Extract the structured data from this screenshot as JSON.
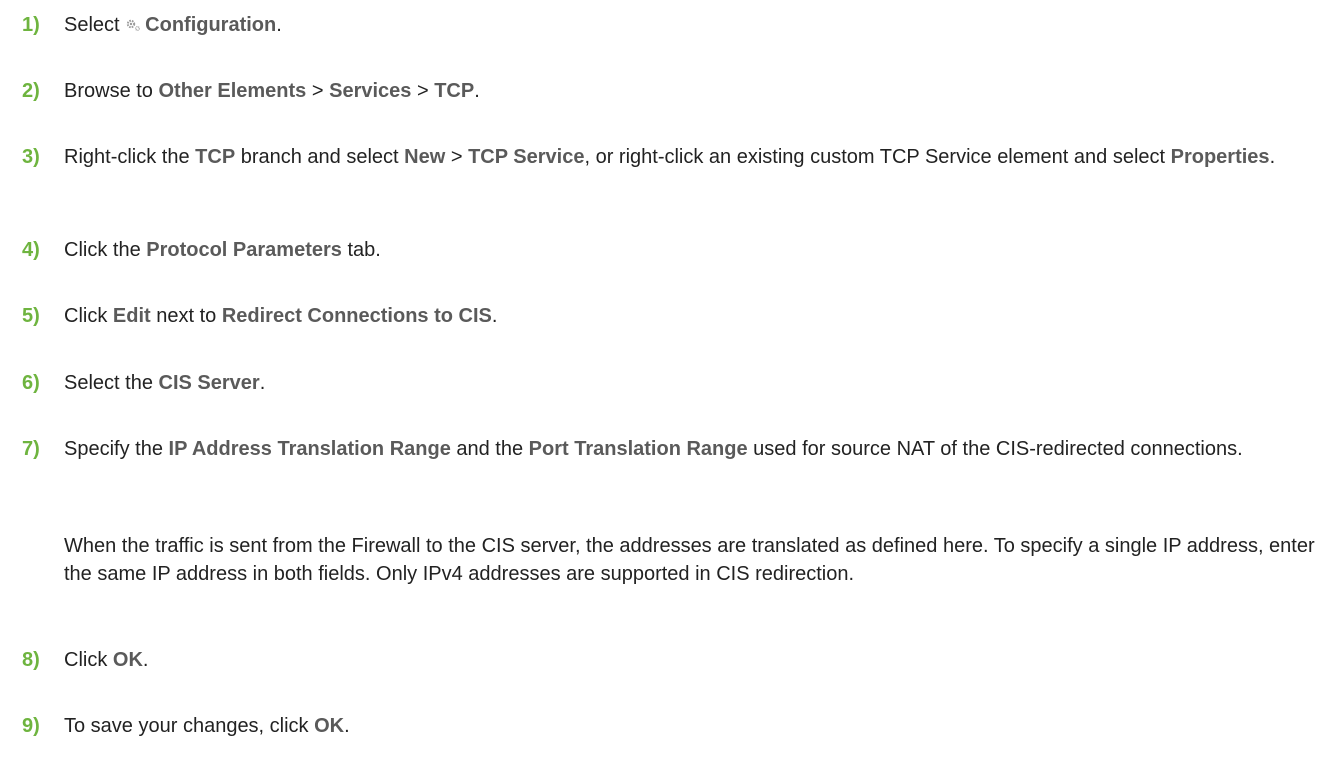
{
  "steps": [
    {
      "number": "1)",
      "parts": [
        {
          "t": "Select "
        },
        {
          "icon": "gear-icon"
        },
        {
          "t": "Configuration",
          "b": true
        },
        {
          "t": "."
        }
      ]
    },
    {
      "number": "2)",
      "parts": [
        {
          "t": "Browse to "
        },
        {
          "t": "Other Elements",
          "b": true
        },
        {
          "t": " > "
        },
        {
          "t": "Services",
          "b": true
        },
        {
          "t": " > "
        },
        {
          "t": "TCP",
          "b": true
        },
        {
          "t": "."
        }
      ]
    },
    {
      "number": "3)",
      "parts": [
        {
          "t": "Right-click the "
        },
        {
          "t": "TCP",
          "b": true
        },
        {
          "t": " branch and select "
        },
        {
          "t": "New",
          "b": true
        },
        {
          "t": " > "
        },
        {
          "t": "TCP Service",
          "b": true
        },
        {
          "t": ", or right-click an existing custom TCP Service element and select "
        },
        {
          "t": "Properties",
          "b": true
        },
        {
          "t": "."
        }
      ]
    },
    {
      "number": "4)",
      "parts": [
        {
          "t": "Click the "
        },
        {
          "t": "Protocol Parameters",
          "b": true
        },
        {
          "t": " tab."
        }
      ]
    },
    {
      "number": "5)",
      "parts": [
        {
          "t": "Click "
        },
        {
          "t": "Edit",
          "b": true
        },
        {
          "t": " next to "
        },
        {
          "t": "Redirect Connections to CIS",
          "b": true
        },
        {
          "t": "."
        }
      ]
    },
    {
      "number": "6)",
      "parts": [
        {
          "t": "Select the "
        },
        {
          "t": "CIS Server",
          "b": true
        },
        {
          "t": "."
        }
      ]
    },
    {
      "number": "7)",
      "parts": [
        {
          "t": "Specify the "
        },
        {
          "t": "IP Address Translation Range",
          "b": true
        },
        {
          "t": " and the "
        },
        {
          "t": "Port Translation Range",
          "b": true
        },
        {
          "t": " used for source NAT of the CIS-redirected connections."
        }
      ],
      "note": "When the traffic is sent from the Firewall to the CIS server, the addresses are translated as defined here. To specify a single IP address, enter the same IP address in both fields. Only IPv4 addresses are supported in CIS redirection."
    },
    {
      "number": "8)",
      "parts": [
        {
          "t": "Click "
        },
        {
          "t": "OK",
          "b": true
        },
        {
          "t": "."
        }
      ]
    },
    {
      "number": "9)",
      "parts": [
        {
          "t": "To save your changes, click "
        },
        {
          "t": "OK",
          "b": true
        },
        {
          "t": "."
        }
      ]
    }
  ],
  "colors": {
    "step_number": "#6eb43f",
    "ui_term": "#5a5a5a",
    "body_text": "#222222"
  }
}
